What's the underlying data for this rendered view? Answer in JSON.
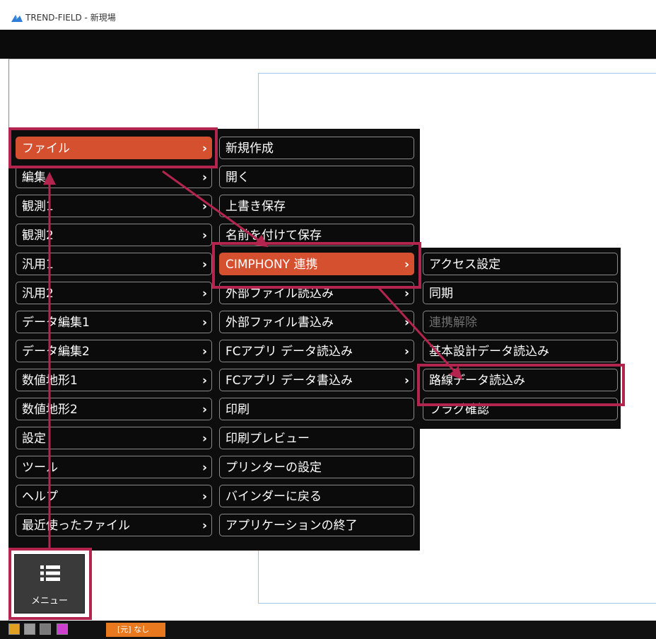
{
  "window": {
    "title": "TREND-FIELD - 新現場"
  },
  "colors": {
    "accent": "#d4502f",
    "highlight": "#b3254f",
    "status_label": "#e8791f"
  },
  "main_menu": {
    "items": [
      {
        "label": "ファイル",
        "arrow": "›"
      },
      {
        "label": "編集",
        "arrow": "›"
      },
      {
        "label": "観測1",
        "arrow": "›"
      },
      {
        "label": "観測2",
        "arrow": "›"
      },
      {
        "label": "汎用1",
        "arrow": "›"
      },
      {
        "label": "汎用2",
        "arrow": "›"
      },
      {
        "label": "データ編集1",
        "arrow": "›"
      },
      {
        "label": "データ編集2",
        "arrow": "›"
      },
      {
        "label": "数値地形1",
        "arrow": "›"
      },
      {
        "label": "数値地形2",
        "arrow": "›"
      },
      {
        "label": "設定",
        "arrow": "›"
      },
      {
        "label": "ツール",
        "arrow": "›"
      },
      {
        "label": "ヘルプ",
        "arrow": "›"
      },
      {
        "label": "最近使ったファイル",
        "arrow": "›"
      }
    ]
  },
  "file_menu": {
    "items": [
      {
        "label": "新規作成"
      },
      {
        "label": "開く"
      },
      {
        "label": "上書き保存"
      },
      {
        "label": "名前を付けて保存"
      },
      {
        "label": "CIMPHONY 連携",
        "arrow": "›"
      },
      {
        "label": "外部ファイル読込み",
        "arrow": "›"
      },
      {
        "label": "外部ファイル書込み",
        "arrow": "›"
      },
      {
        "label": "FCアプリ データ読込み",
        "arrow": "›"
      },
      {
        "label": "FCアプリ データ書込み",
        "arrow": "›"
      },
      {
        "label": "印刷"
      },
      {
        "label": "印刷プレビュー"
      },
      {
        "label": "プリンターの設定"
      },
      {
        "label": "バインダーに戻る"
      },
      {
        "label": "アプリケーションの終了"
      }
    ]
  },
  "cimphony_menu": {
    "items": [
      {
        "label": "アクセス設定"
      },
      {
        "label": "同期"
      },
      {
        "label": "連携解除"
      },
      {
        "label": "基本設計データ読込み"
      },
      {
        "label": "路線データ読込み"
      },
      {
        "label": "フラグ確認"
      }
    ]
  },
  "menu_button": {
    "label": "メニュー",
    "icon": "list-menu-icon"
  },
  "statusbar": {
    "label": "[元] なし"
  }
}
